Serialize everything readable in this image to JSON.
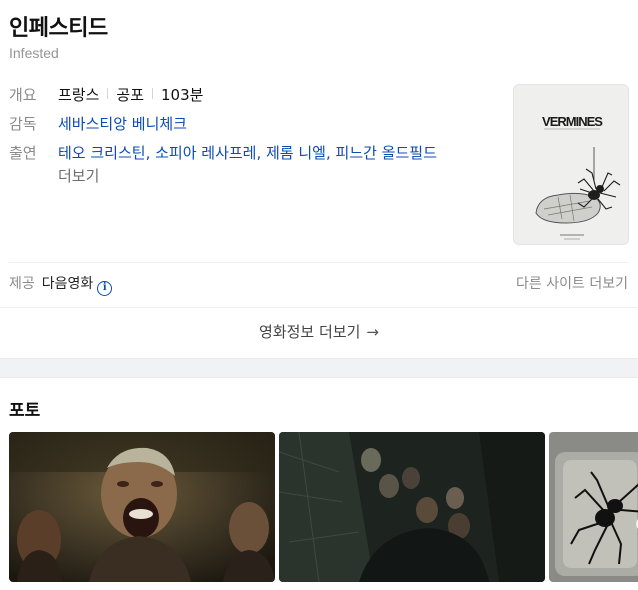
{
  "movie": {
    "title": "인페스티드",
    "original_title": "Infested"
  },
  "info": {
    "overview_label": "개요",
    "country": "프랑스",
    "genre": "공포",
    "runtime": "103분",
    "director_label": "감독",
    "director": "세바스티앙 베니체크",
    "cast_label": "출연",
    "cast": "테오 크리스틴, 소피아 레사프레, 제롬 니엘, 피느간 올드필드",
    "cast_more": "더보기"
  },
  "poster": {
    "title_text": "VERMINES"
  },
  "provider": {
    "label": "제공",
    "name": "다음영화",
    "info_icon_glyph": "i",
    "other_sites": "다른 사이트 더보기"
  },
  "more_info": {
    "label": "영화정보 더보기",
    "arrow_glyph": "→"
  },
  "photos": {
    "title": "포토"
  },
  "colors": {
    "link": "#0b4bb7",
    "label": "#8a8a8a",
    "divider_band": "#f1f2f4"
  }
}
